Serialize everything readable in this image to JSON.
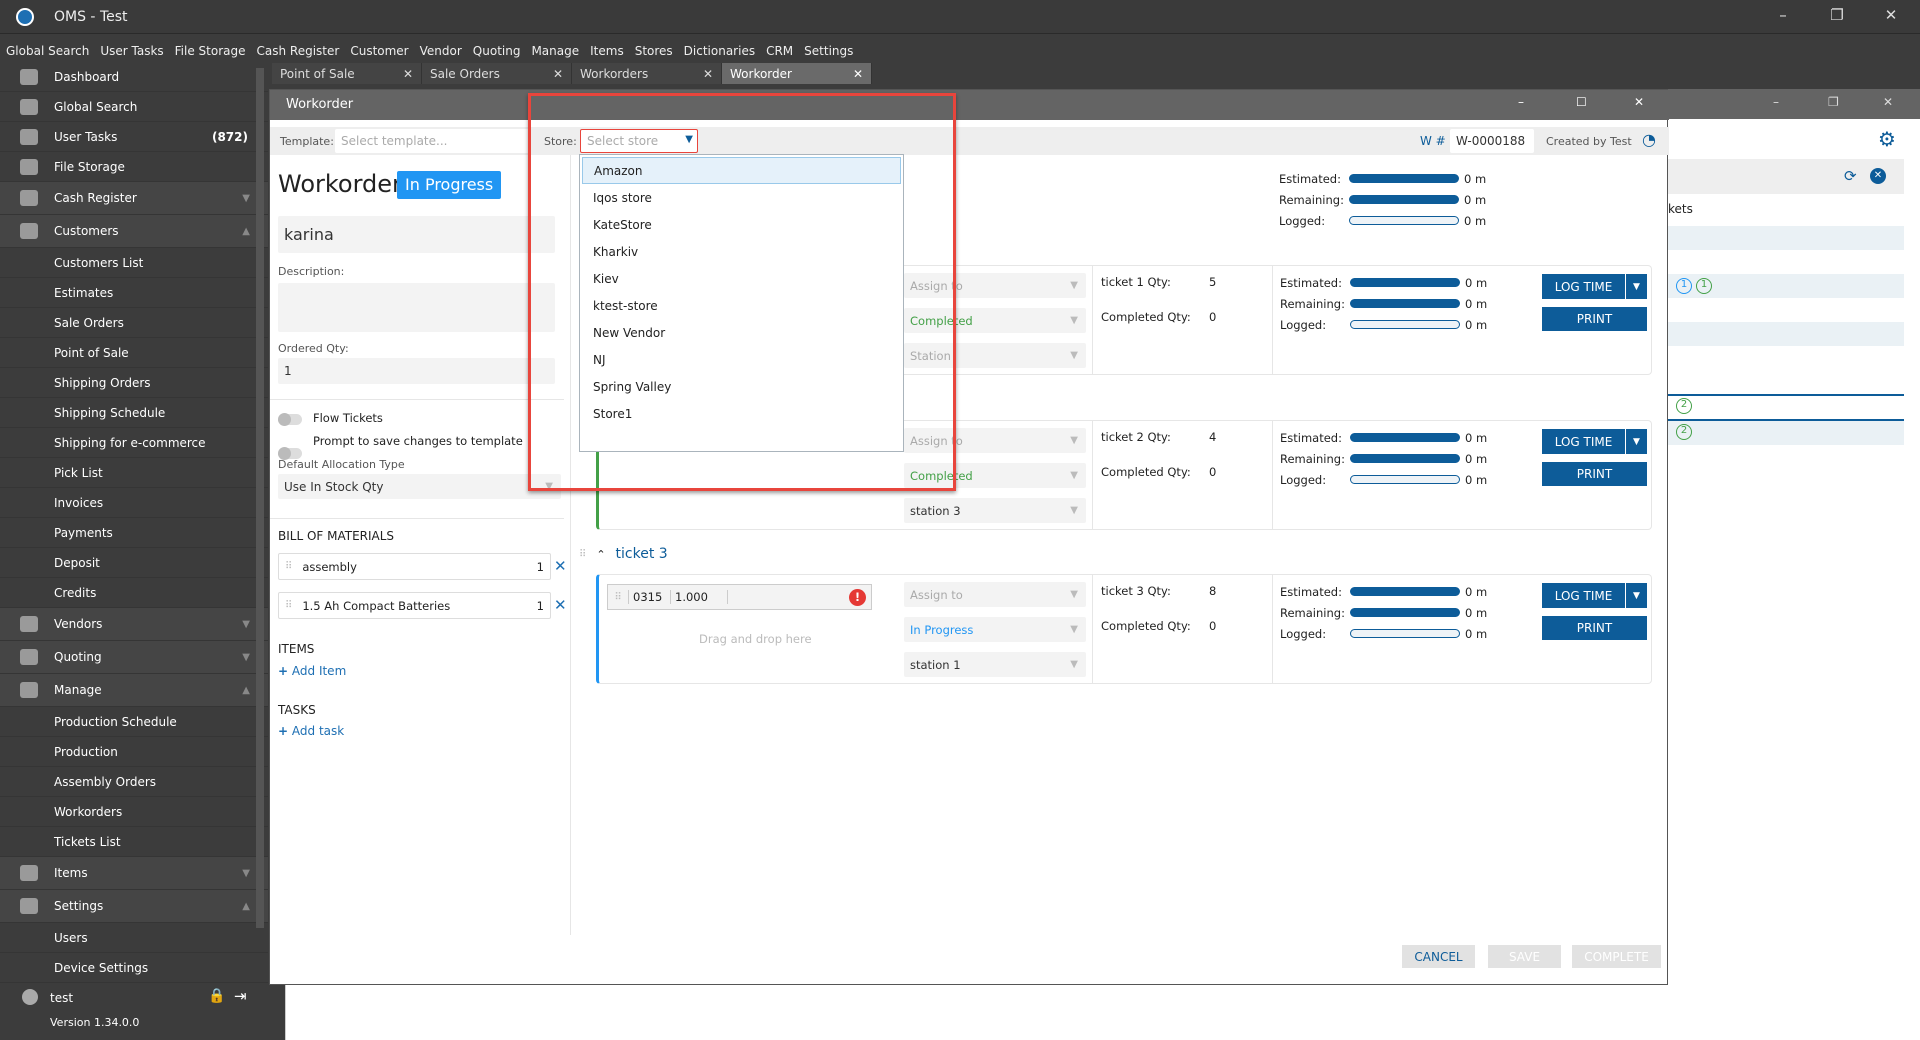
{
  "app": {
    "title": "OMS - Test"
  },
  "menu": [
    "Global Search",
    "User Tasks",
    "File Storage",
    "Cash Register",
    "Customer",
    "Vendor",
    "Quoting",
    "Manage",
    "Items",
    "Stores",
    "Dictionaries",
    "CRM",
    "Settings"
  ],
  "sidebar": {
    "items": [
      {
        "label": "Dashboard",
        "type": "top"
      },
      {
        "label": "Global Search",
        "type": "top"
      },
      {
        "label": "User Tasks",
        "type": "top",
        "badge": "(872)"
      },
      {
        "label": "File Storage",
        "type": "top"
      },
      {
        "label": "Cash Register",
        "type": "group",
        "chevron": "down"
      },
      {
        "label": "Customers",
        "type": "group",
        "chevron": "up"
      },
      {
        "label": "Customers List",
        "type": "sub"
      },
      {
        "label": "Estimates",
        "type": "sub"
      },
      {
        "label": "Sale Orders",
        "type": "sub"
      },
      {
        "label": "Point of Sale",
        "type": "sub"
      },
      {
        "label": "Shipping Orders",
        "type": "sub"
      },
      {
        "label": "Shipping Schedule",
        "type": "sub"
      },
      {
        "label": "Shipping for e-commerce",
        "type": "sub"
      },
      {
        "label": "Pick List",
        "type": "sub"
      },
      {
        "label": "Invoices",
        "type": "sub"
      },
      {
        "label": "Payments",
        "type": "sub"
      },
      {
        "label": "Deposit",
        "type": "sub"
      },
      {
        "label": "Credits",
        "type": "sub"
      },
      {
        "label": "Vendors",
        "type": "group",
        "chevron": "down"
      },
      {
        "label": "Quoting",
        "type": "group",
        "chevron": "down"
      },
      {
        "label": "Manage",
        "type": "group",
        "chevron": "up"
      },
      {
        "label": "Production Schedule",
        "type": "sub"
      },
      {
        "label": "Production",
        "type": "sub"
      },
      {
        "label": "Assembly Orders",
        "type": "sub"
      },
      {
        "label": "Workorders",
        "type": "sub"
      },
      {
        "label": "Tickets List",
        "type": "sub"
      },
      {
        "label": "Items",
        "type": "group",
        "chevron": "down"
      },
      {
        "label": "Settings",
        "type": "group",
        "chevron": "up"
      },
      {
        "label": "Users",
        "type": "sub"
      },
      {
        "label": "Device Settings",
        "type": "sub"
      }
    ],
    "user": "test",
    "version": "Version 1.34.0.0"
  },
  "tabs": [
    {
      "label": "Point of Sale"
    },
    {
      "label": "Sale Orders"
    },
    {
      "label": "Workorders"
    },
    {
      "label": "Workorder",
      "active": true
    }
  ],
  "workorder": {
    "window_title": "Workorder",
    "template_label": "Template:",
    "template_placeholder": "Select template...",
    "store_label": "Store:",
    "store_placeholder": "Select store",
    "wnum_label": "W #",
    "wnum": "W-0000188",
    "created_by": "Created by Test",
    "heading": "Workorder",
    "status": "In Progress",
    "name": "karina",
    "description_label": "Description:",
    "description": "",
    "ordered_qty_label": "Ordered Qty:",
    "ordered_qty": "1",
    "flow_tickets": "Flow Tickets",
    "prompt_save": "Prompt to save changes to template",
    "alloc_label": "Default Allocation Type",
    "alloc_value": "Use In Stock Qty",
    "bom_title": "BILL OF MATERIALS",
    "bom": [
      {
        "name": "assembly",
        "qty": "1"
      },
      {
        "name": "1.5 Ah Compact Batteries",
        "qty": "1"
      }
    ],
    "items_title": "ITEMS",
    "add_item": "Add Item",
    "tasks_title": "TASKS",
    "add_task": "Add task",
    "summary": {
      "estimated": "Estimated:",
      "remaining": "Remaining:",
      "logged": "Logged:",
      "est_val": "0 m",
      "rem_val": "0 m",
      "log_val": "0 m"
    },
    "cancel": "CANCEL",
    "save": "SAVE",
    "complete": "COMPLETE"
  },
  "tickets": [
    {
      "assign": "Assign to",
      "status": "Completed",
      "station": "Station",
      "qty_label": "ticket 1 Qty:",
      "qty": "5",
      "completed_label": "Completed Qty:",
      "completed": "0",
      "est": "0 m",
      "rem": "0 m",
      "log": "0 m",
      "log_time": "LOG TIME",
      "print": "PRINT",
      "status_color": "#43a047"
    },
    {
      "assign": "Assign to",
      "status": "Completed",
      "station": "station 3",
      "qty_label": "ticket 2 Qty:",
      "qty": "4",
      "completed_label": "Completed Qty:",
      "completed": "0",
      "est": "0 m",
      "rem": "0 m",
      "log": "0 m",
      "log_time": "LOG TIME",
      "print": "PRINT",
      "status_color": "#43a047"
    },
    {
      "title": "ticket 3",
      "item_code": "0315",
      "item_qty": "1.000",
      "drag_hint": "Drag and drop here",
      "assign": "Assign to",
      "status": "In Progress",
      "station": "station 1",
      "qty_label": "ticket 3 Qty:",
      "qty": "8",
      "completed_label": "Completed Qty:",
      "completed": "0",
      "est": "0 m",
      "rem": "0 m",
      "log": "0 m",
      "log_time": "LOG TIME",
      "print": "PRINT",
      "status_color": "#2196f3"
    }
  ],
  "store_options": [
    "Amazon",
    "Iqos store",
    "KateStore",
    "Kharkiv",
    "Kiev",
    "ktest-store",
    "New Vendor",
    "NJ",
    "Spring Valley",
    "Store1"
  ],
  "background_window": {
    "column": "kets",
    "badges": [
      "1",
      "1",
      "2",
      "2"
    ]
  },
  "colors": {
    "accent": "#0d5c99",
    "status_badge": "#2196f3",
    "highlight": "#e8453c",
    "completed": "#43a047"
  }
}
